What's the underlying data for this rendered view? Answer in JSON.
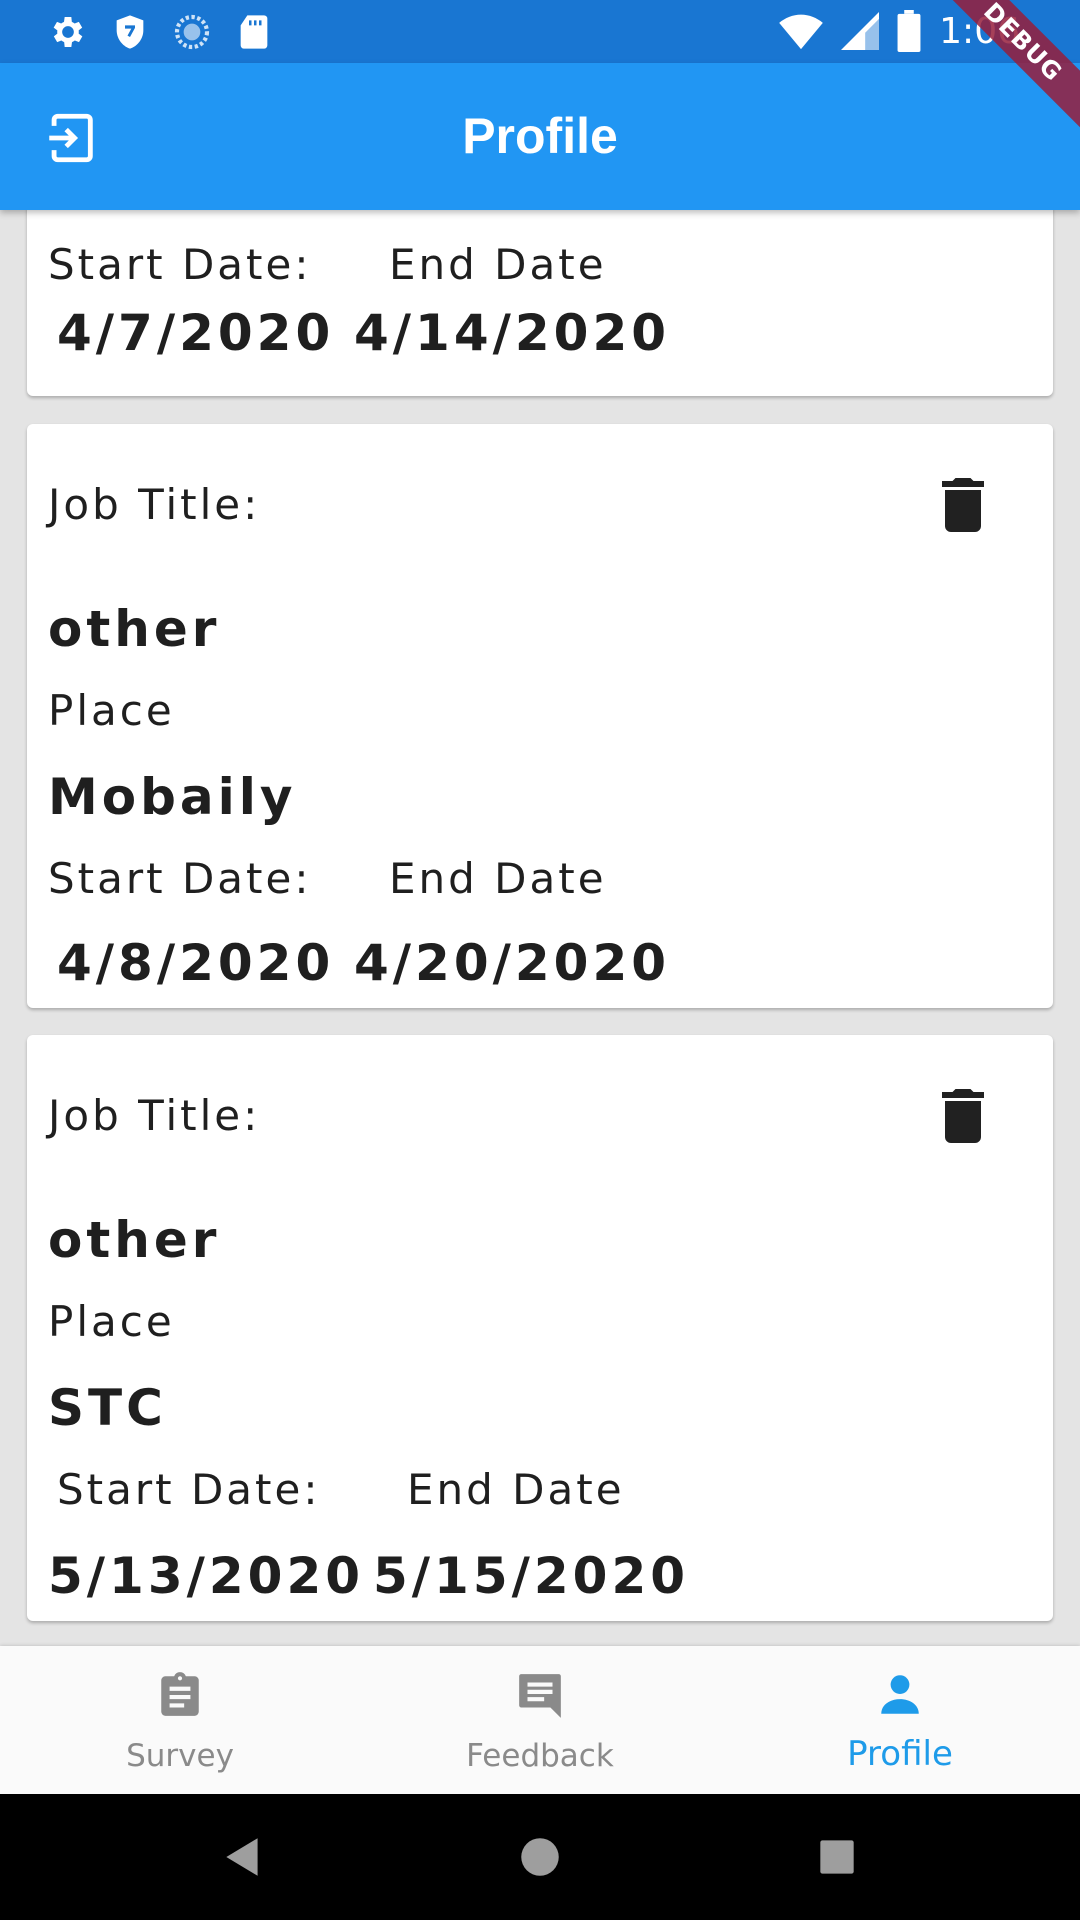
{
  "status_bar": {
    "time": "1:06",
    "icons_left": [
      "settings-icon",
      "shield-icon",
      "sync-icon",
      "sd-card-icon"
    ],
    "icons_right": [
      "wifi-icon",
      "signal-icon",
      "battery-icon"
    ]
  },
  "debug_banner": "DEBUG",
  "app_bar": {
    "title": "Profile",
    "leading_icon": "exit-icon"
  },
  "cards": [
    {
      "start_label": "Start Date:",
      "end_label": "End Date",
      "start_date": "4/7/2020",
      "end_date": "4/14/2020"
    },
    {
      "job_title_label": "Job Title:",
      "job_title": "other",
      "place_label": "Place",
      "place": "Mobaily",
      "start_label": "Start Date:",
      "end_label": "End Date",
      "start_date": "4/8/2020",
      "end_date": "4/20/2020"
    },
    {
      "job_title_label": "Job Title:",
      "job_title": "other",
      "place_label": "Place",
      "place": "STC",
      "start_label": "Start Date:",
      "end_label": "End Date",
      "start_date": "5/13/2020",
      "end_date": "5/15/2020"
    }
  ],
  "bottom_nav": {
    "items": [
      {
        "label": "Survey",
        "icon": "clipboard-icon",
        "active": false
      },
      {
        "label": "Feedback",
        "icon": "feedback-icon",
        "active": false
      },
      {
        "label": "Profile",
        "icon": "person-icon",
        "active": true
      }
    ]
  },
  "colors": {
    "app_bar": "#2196f3",
    "status_bar": "#1976d2",
    "active_nav": "#1e9be9",
    "inactive_nav": "#8a8a8a",
    "background": "#e4e4e4"
  }
}
